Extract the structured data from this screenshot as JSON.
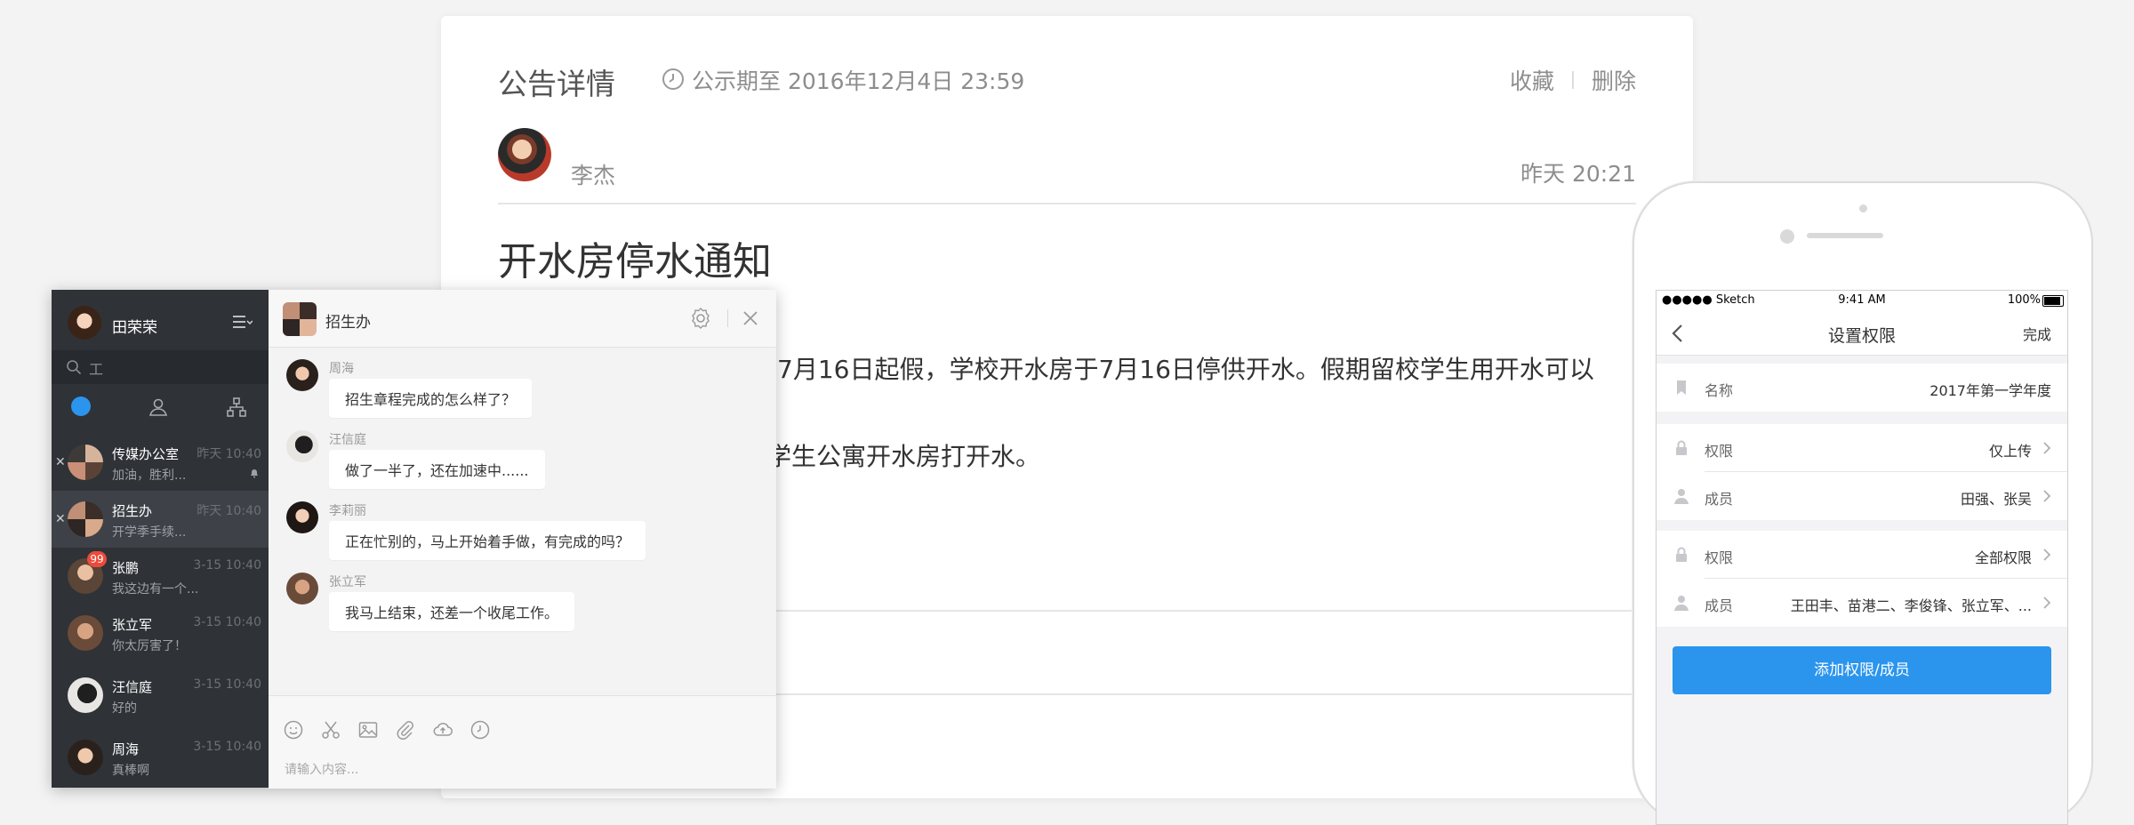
{
  "notice": {
    "title": "公告详情",
    "period": "公示期至 2016年12月4日 23:59",
    "actions": {
      "favorite": "收藏",
      "delete": "删除"
    },
    "author": "李杰",
    "time": "昨天 20:21",
    "heading": "开水房停水通知",
    "paragraph1": "7月16日起假，学校开水房于7月16日停供开水。假期留校学生用开水可以",
    "paragraph2": "学生公寓开水房打开水。"
  },
  "chat": {
    "user": {
      "name": "田荣荣"
    },
    "search": {
      "text": "工"
    },
    "conversations": [
      {
        "name": "传媒办公室",
        "time": "昨天 10:40",
        "preview": "加油，胜利...",
        "closable": true,
        "muted": true
      },
      {
        "name": "招生办",
        "time": "昨天 10:40",
        "preview": "开学季手续...",
        "closable": true,
        "active": true
      },
      {
        "name": "张鹏",
        "time": "3-15 10:40",
        "preview": "我这边有一个...",
        "badge": "99"
      },
      {
        "name": "张立军",
        "time": "3-15 10:40",
        "preview": "你太厉害了！"
      },
      {
        "name": "汪信庭",
        "time": "3-15 10:40",
        "preview": "好的"
      },
      {
        "name": "周海",
        "time": "3-15 10:40",
        "preview": "真棒啊"
      }
    ],
    "group": {
      "title": "招生办"
    },
    "messages": [
      {
        "sender": "周海",
        "text": "招生章程完成的怎么样了？"
      },
      {
        "sender": "汪信庭",
        "text": "做了一半了，还在加速中......"
      },
      {
        "sender": "李莉丽",
        "text": "正在忙别的，马上开始着手做，有完成的吗？"
      },
      {
        "sender": "张立军",
        "text": "我马上结束，还差一个收尾工作。"
      }
    ],
    "composer": {
      "placeholder": "请输入内容..."
    }
  },
  "phone": {
    "status": {
      "carrier": "●●●●● Sketch",
      "time": "9:41 AM",
      "battery": "100%"
    },
    "nav": {
      "title": "设置权限",
      "done": "完成"
    },
    "rows": [
      {
        "label": "名称",
        "value": "2017年第一学年度",
        "icon": "bookmark-icon"
      },
      {
        "label": "权限",
        "value": "仅上传",
        "icon": "lock-icon"
      },
      {
        "label": "成员",
        "value": "田强、张吴",
        "icon": "person-icon"
      },
      {
        "label": "权限",
        "value": "全部权限",
        "icon": "lock-icon"
      },
      {
        "label": "成员",
        "value": "王田丰、苗港二、李俊锋、张立军、...",
        "icon": "person-icon"
      }
    ],
    "add_button": "添加权限/成员"
  },
  "colors": {
    "accent": "#2b95ee",
    "sidebar": "#2f3237",
    "badge": "#ec4a3a"
  }
}
